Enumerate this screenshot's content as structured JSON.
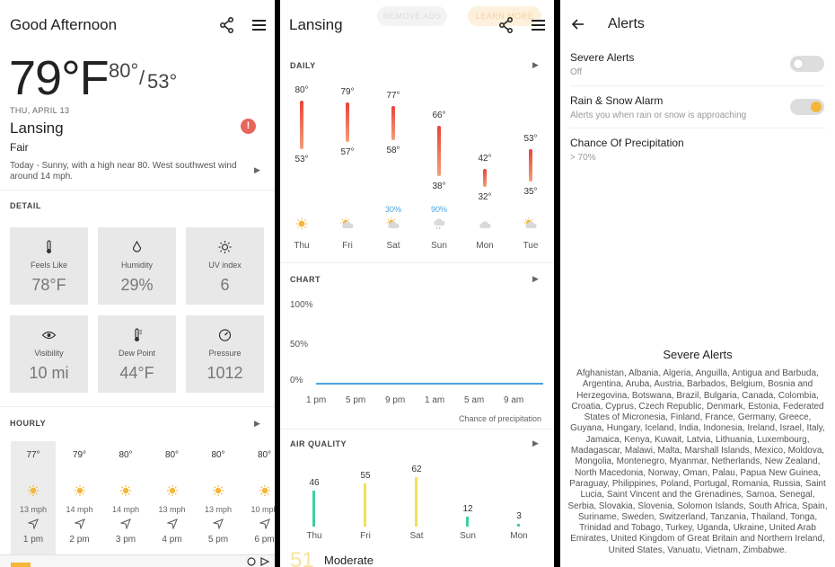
{
  "panel1": {
    "header_title": "Good Afternoon",
    "current_temp": "79°F",
    "high": "80°",
    "slash": "/",
    "low": "53°",
    "date": "THU, APRIL 13",
    "city": "Lansing",
    "condition": "Fair",
    "summary": "Today - Sunny, with a high near 80. West southwest wind around 14 mph.",
    "detail_label": "DETAIL",
    "details": [
      {
        "label": "Feels Like",
        "value": "78°F",
        "icon": "thermometer-icon"
      },
      {
        "label": "Humidity",
        "value": "29%",
        "icon": "droplet-icon"
      },
      {
        "label": "UV index",
        "value": "6",
        "icon": "sun-icon"
      },
      {
        "label": "Visibility",
        "value": "10 mi",
        "icon": "eye-icon"
      },
      {
        "label": "Dew Point",
        "value": "44°F",
        "icon": "thermometer-icon"
      },
      {
        "label": "Pressure",
        "value": "1012",
        "icon": "gauge-icon"
      }
    ],
    "hourly_label": "HOURLY",
    "hourly": [
      {
        "temp": "77°",
        "wind": "13 mph",
        "hour": "1 pm"
      },
      {
        "temp": "79°",
        "wind": "14 mph",
        "hour": "2 pm"
      },
      {
        "temp": "80°",
        "wind": "14 mph",
        "hour": "3 pm"
      },
      {
        "temp": "80°",
        "wind": "13 mph",
        "hour": "4 pm"
      },
      {
        "temp": "80°",
        "wind": "13 mph",
        "hour": "5 pm"
      },
      {
        "temp": "80°",
        "wind": "10 mph",
        "hour": "6 pm"
      }
    ]
  },
  "panel2": {
    "header_title": "Lansing",
    "ad_remove": "REMOVE ADS",
    "ad_learn": "LEARN MORE",
    "daily_label": "DAILY",
    "daily": [
      {
        "day": "Thu",
        "high": 80,
        "low": 53,
        "high_label": "80°",
        "low_label": "53°",
        "precip": "",
        "icon": "sunny-icon"
      },
      {
        "day": "Fri",
        "high": 79,
        "low": 57,
        "high_label": "79°",
        "low_label": "57°",
        "precip": "",
        "icon": "partly-cloudy-icon"
      },
      {
        "day": "Sat",
        "high": 77,
        "low": 58,
        "high_label": "77°",
        "low_label": "58°",
        "precip": "30%",
        "icon": "partly-cloudy-icon"
      },
      {
        "day": "Sun",
        "high": 66,
        "low": 38,
        "high_label": "66°",
        "low_label": "38°",
        "precip": "90%",
        "icon": "rain-cloud-icon"
      },
      {
        "day": "Mon",
        "high": 42,
        "low": 32,
        "high_label": "42°",
        "low_label": "32°",
        "precip": "",
        "icon": "cloud-icon"
      },
      {
        "day": "Tue",
        "high": 53,
        "low": 35,
        "high_label": "53°",
        "low_label": "35°",
        "precip": "",
        "icon": "partly-cloudy-icon"
      }
    ],
    "chart_label": "CHART",
    "chart_yticks": [
      "100%",
      "50%",
      "0%"
    ],
    "chart_xticks": [
      "1 pm",
      "5 pm",
      "9 pm",
      "1 am",
      "5 am",
      "9 am"
    ],
    "chart_caption": "Chance of precipitation",
    "aq_label": "AIR QUALITY",
    "air_quality": [
      {
        "day": "Thu",
        "value": 46,
        "label": "46",
        "color": "#3fd0a0"
      },
      {
        "day": "Fri",
        "value": 55,
        "label": "55",
        "color": "#f2e05a"
      },
      {
        "day": "Sat",
        "value": 62,
        "label": "62",
        "color": "#f2e05a"
      },
      {
        "day": "Sun",
        "value": 12,
        "label": "12",
        "color": "#3fd0a0"
      },
      {
        "day": "Mon",
        "value": 3,
        "label": "3",
        "color": "#3fd0a0"
      }
    ],
    "aq_big": "51",
    "aq_status": "Moderate"
  },
  "panel3": {
    "header_title": "Alerts",
    "settings": [
      {
        "title": "Severe Alerts",
        "subtitle": "Off",
        "toggle": false
      },
      {
        "title": "Rain & Snow Alarm",
        "subtitle": "Alerts you when rain or snow is approaching",
        "toggle": true
      },
      {
        "title": "Chance Of Precipitation",
        "subtitle": "> 70%"
      }
    ],
    "severe_heading": "Severe Alerts",
    "countries": "Afghanistan, Albania, Algeria, Anguilla, Antigua and Barbuda, Argentina, Aruba, Austria, Barbados, Belgium, Bosnia and Herzegovina, Botswana, Brazil, Bulgaria, Canada, Colombia, Croatia, Cyprus, Czech Republic, Denmark, Estonia, Federated States of Micronesia, Finland, France, Germany, Greece, Guyana, Hungary, Iceland, India, Indonesia, Ireland, Israel, Italy, Jamaica, Kenya, Kuwait, Latvia, Lithuania, Luxembourg, Madagascar, Malawi, Malta, Marshall Islands, Mexico, Moldova, Mongolia, Montenegro, Myanmar, Netherlands, New Zealand, North Macedonia, Norway, Oman, Palau, Papua New Guinea, Paraguay, Philippines, Poland, Portugal, Romania, Russia, Saint Lucia, Saint Vincent and the Grenadines, Samoa, Senegal, Serbia, Slovakia, Slovenia, Solomon Islands, South Africa, Spain, Suriname, Sweden, Switzerland, Tanzania, Thailand, Tonga, Trinidad and Tobago, Turkey, Uganda, Ukraine, United Arab Emirates, United Kingdom of Great Britain and Northern Ireland, United States, Vanuatu, Vietnam, Zimbabwe."
  },
  "colors": {
    "accent": "#f4b73a",
    "alert": "#e8665c",
    "precip": "#4aa3df"
  }
}
